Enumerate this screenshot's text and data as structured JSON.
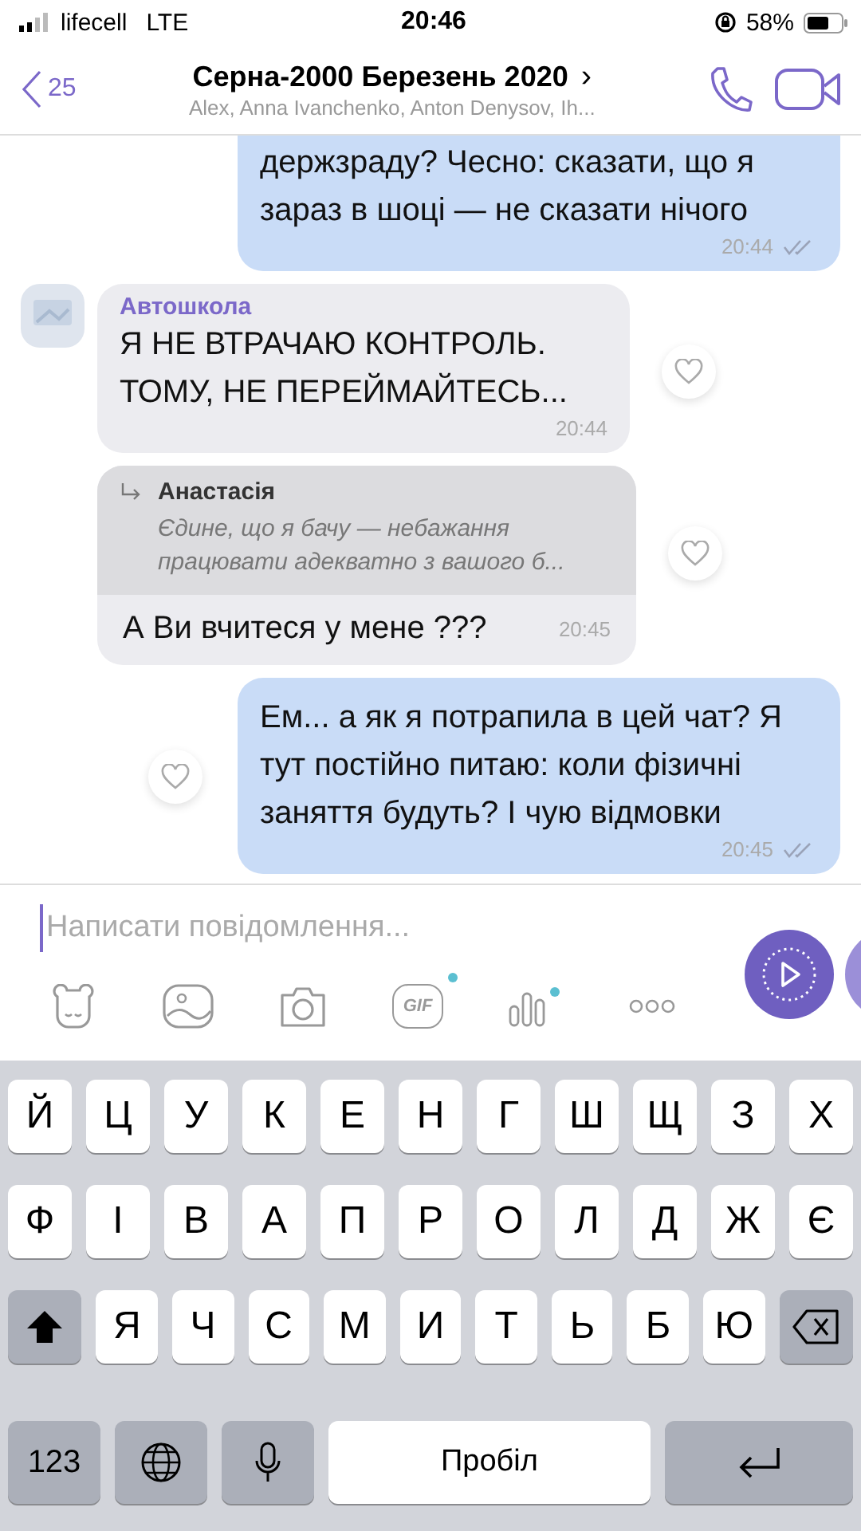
{
  "status_bar": {
    "carrier": "lifecell",
    "network": "LTE",
    "time": "20:46",
    "battery": "58%"
  },
  "header": {
    "back_count": "25",
    "title": "Серна-2000 Березень 2020",
    "title_chevron": "›",
    "members": "Alex, Anna Ivanchenko, Anton Denysov, Ih..."
  },
  "messages": [
    {
      "kind": "sent",
      "text": "держзраду? Чесно: сказати, що я зараз в шоці — не сказати нічого",
      "time": "20:44",
      "top_cut": true
    },
    {
      "kind": "received",
      "sender": "Автошкола",
      "text": "Я НЕ ВТРАЧАЮ КОНТРОЛЬ. ТОМУ, НЕ ПЕРЕЙМАЙТЕСЬ...",
      "time": "20:44"
    },
    {
      "kind": "reply",
      "quote_author": "Анастасія",
      "quote_text": "Єдине, що я бачу — небажання працювати адекватно з вашого б...",
      "text": "А Ви вчитеся у мене ???",
      "time": "20:45"
    },
    {
      "kind": "sent",
      "text": "Ем... а як я потрапила в цей чат? Я тут постійно питаю: коли фізичні заняття будуть? І чую відмовки",
      "time": "20:45"
    }
  ],
  "composer": {
    "placeholder": "Написати повідомлення...",
    "gif_label": "GIF"
  },
  "keyboard": [
    [
      {
        "kind": "letter",
        "label": "Й"
      },
      {
        "kind": "letter",
        "label": "Ц"
      },
      {
        "kind": "letter",
        "label": "У"
      },
      {
        "kind": "letter",
        "label": "К"
      },
      {
        "kind": "letter",
        "label": "Е"
      },
      {
        "kind": "letter",
        "label": "Н"
      },
      {
        "kind": "letter",
        "label": "Г"
      },
      {
        "kind": "letter",
        "label": "Ш"
      },
      {
        "kind": "letter",
        "label": "Щ"
      },
      {
        "kind": "letter",
        "label": "З"
      },
      {
        "kind": "letter",
        "label": "Х"
      }
    ],
    [
      {
        "kind": "letter",
        "label": "Ф"
      },
      {
        "kind": "letter",
        "label": "І"
      },
      {
        "kind": "letter",
        "label": "В"
      },
      {
        "kind": "letter",
        "label": "А"
      },
      {
        "kind": "letter",
        "label": "П"
      },
      {
        "kind": "letter",
        "label": "Р"
      },
      {
        "kind": "letter",
        "label": "О"
      },
      {
        "kind": "letter",
        "label": "Л"
      },
      {
        "kind": "letter",
        "label": "Д"
      },
      {
        "kind": "letter",
        "label": "Ж"
      },
      {
        "kind": "letter",
        "label": "Є"
      }
    ],
    [
      {
        "kind": "shift"
      },
      {
        "kind": "letter",
        "label": "Я"
      },
      {
        "kind": "letter",
        "label": "Ч"
      },
      {
        "kind": "letter",
        "label": "С"
      },
      {
        "kind": "letter",
        "label": "М"
      },
      {
        "kind": "letter",
        "label": "И"
      },
      {
        "kind": "letter",
        "label": "Т"
      },
      {
        "kind": "letter",
        "label": "Ь"
      },
      {
        "kind": "letter",
        "label": "Б"
      },
      {
        "kind": "letter",
        "label": "Ю"
      },
      {
        "kind": "backspace"
      }
    ],
    [
      {
        "kind": "mode",
        "label": "123"
      },
      {
        "kind": "globe"
      },
      {
        "kind": "mic"
      },
      {
        "kind": "space",
        "label": "Пробіл"
      },
      {
        "kind": "return"
      }
    ]
  ]
}
